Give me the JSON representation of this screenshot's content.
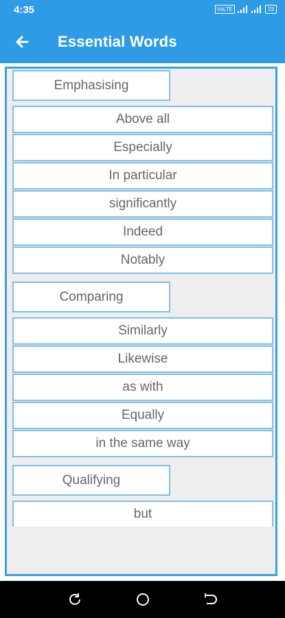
{
  "status": {
    "time": "4:35",
    "volte": "VoLTE",
    "battery": "23"
  },
  "appbar": {
    "title": "Essential Words"
  },
  "sections": [
    {
      "header": "Emphasising",
      "words": [
        "Above all",
        "Especially",
        "In particular",
        "significantly",
        "Indeed",
        "Notably"
      ]
    },
    {
      "header": "Comparing",
      "words": [
        "Similarly",
        "Likewise",
        "as with",
        "Equally",
        "in the same way"
      ]
    },
    {
      "header": "Qualifying",
      "words": [
        "but"
      ]
    }
  ],
  "colors": {
    "primary": "#2f9be6",
    "border": "#7fbde9",
    "background": "#eeeeee"
  }
}
